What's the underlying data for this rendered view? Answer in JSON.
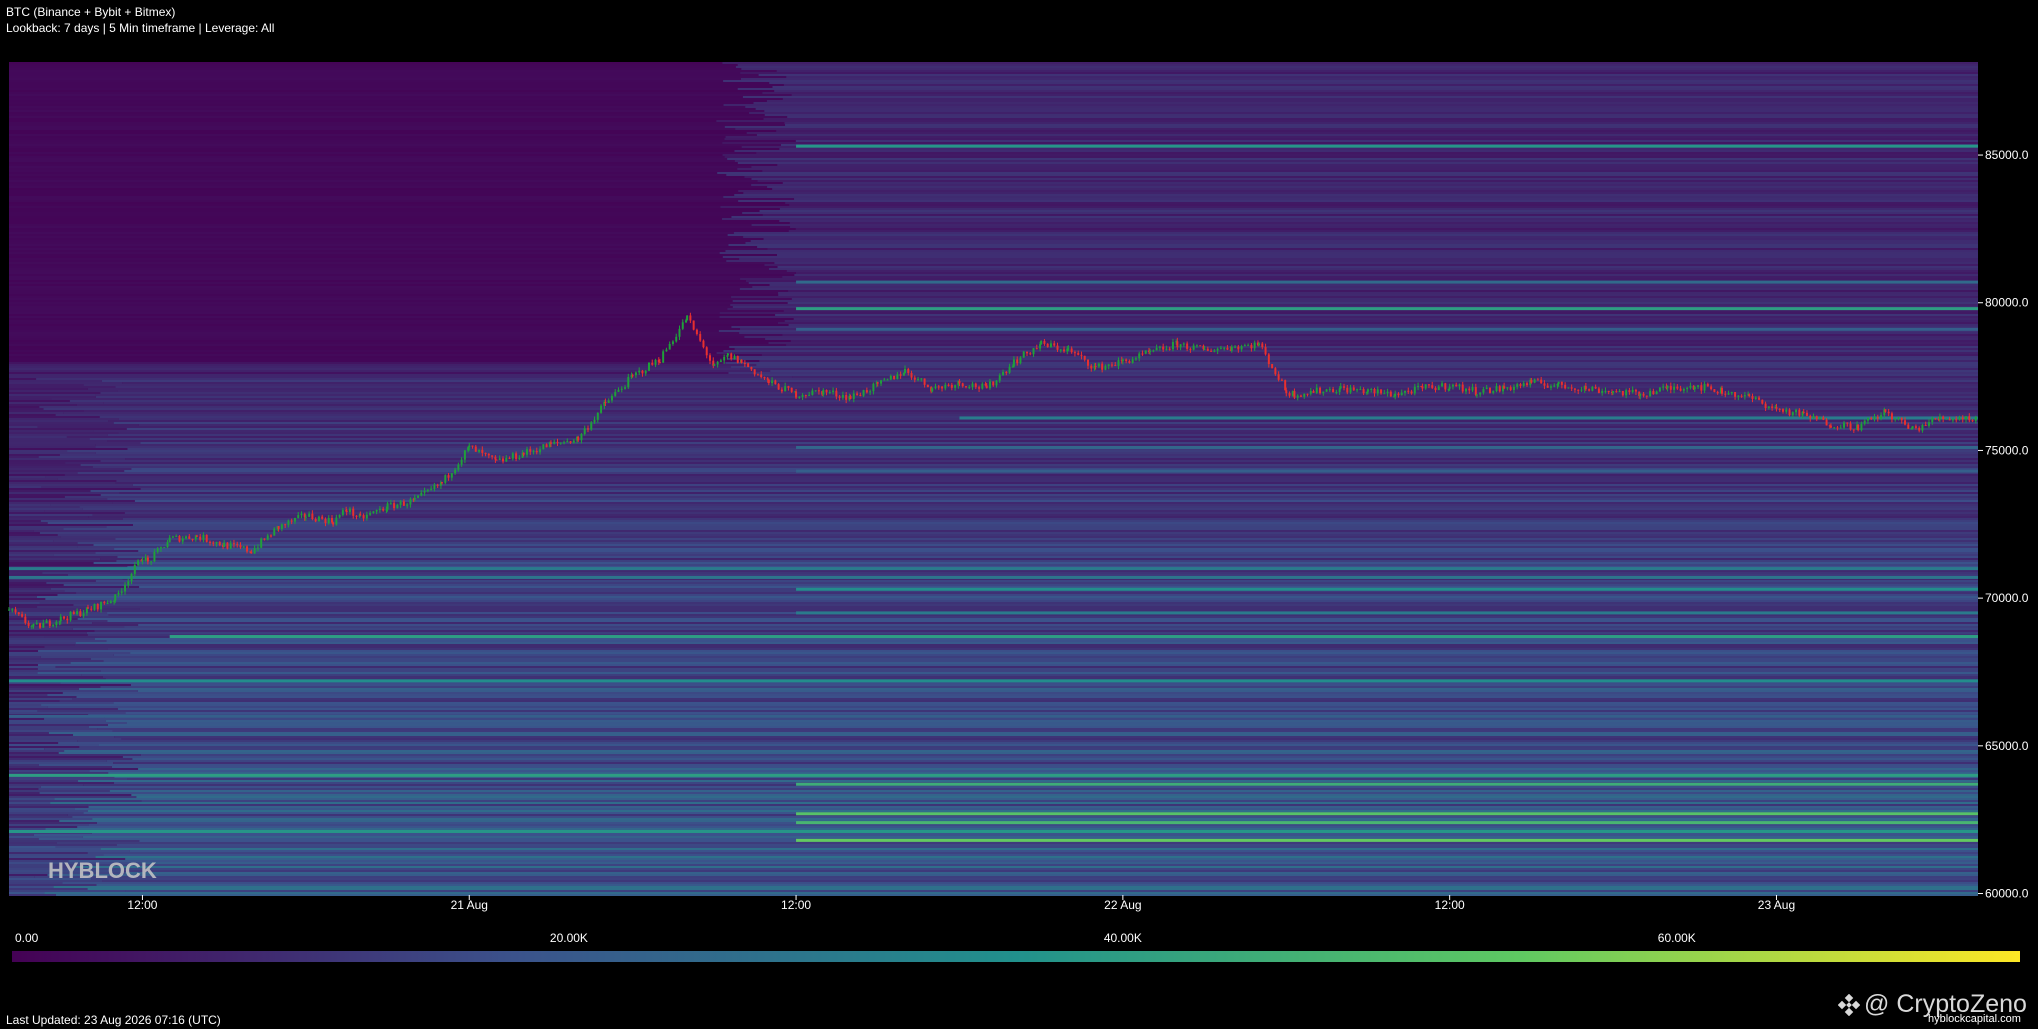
{
  "header": {
    "title": "BTC (Binance + Bybit + Bitmex)",
    "subtitle": "Lookback: 7 days | 5 Min timeframe | Leverage: All"
  },
  "watermark": {
    "logo_text": "HYBLOCK",
    "brand": "@ CryptoZeno",
    "brand_icon": "binance-diamond-icon",
    "url": "hyblockcapital.com"
  },
  "footer": {
    "last_updated": "Last Updated: 23 Aug 2026 07:16 (UTC)"
  },
  "chart_data": {
    "type": "heatmap",
    "title": "",
    "xlabel": "",
    "ylabel": "",
    "x_ticks": [
      "12:00",
      "21 Aug",
      "12:00",
      "22 Aug",
      "12:00",
      "23 Aug"
    ],
    "x_tick_hours": [
      12,
      24,
      36,
      48,
      60,
      72
    ],
    "x_range_hours": [
      7.1,
      79.4
    ],
    "y_ticks": [
      "85000.0",
      "80000.0",
      "75000.0",
      "70000.0",
      "65000.0",
      "60000.0"
    ],
    "y_tick_values": [
      85000,
      80000,
      75000,
      70000,
      65000,
      60000
    ],
    "ylim": [
      59950,
      88150
    ],
    "colorbar": {
      "ticks": [
        "0.00",
        "20.00K",
        "40.00K",
        "60.00K"
      ],
      "tick_values": [
        0,
        20000,
        40000,
        60000
      ],
      "range": [
        0,
        72500
      ],
      "colors": [
        "#440154",
        "#3b528b",
        "#21918c",
        "#5ec962",
        "#fde725"
      ]
    },
    "liquidation_levels": [
      {
        "price": 85300,
        "value": 38000,
        "start_hour": 36
      },
      {
        "price": 80700,
        "value": 25000,
        "start_hour": 36
      },
      {
        "price": 79800,
        "value": 40000,
        "start_hour": 36
      },
      {
        "price": 79100,
        "value": 22000,
        "start_hour": 36
      },
      {
        "price": 76100,
        "value": 30000,
        "start_hour": 42
      },
      {
        "price": 75100,
        "value": 24000,
        "start_hour": 36
      },
      {
        "price": 74300,
        "value": 22000,
        "start_hour": 36
      },
      {
        "price": 71000,
        "value": 30000,
        "start_hour": 7.1
      },
      {
        "price": 70700,
        "value": 28000,
        "start_hour": 7.1
      },
      {
        "price": 70300,
        "value": 35000,
        "start_hour": 36
      },
      {
        "price": 69500,
        "value": 30000,
        "start_hour": 36
      },
      {
        "price": 68700,
        "value": 40000,
        "start_hour": 13
      },
      {
        "price": 67200,
        "value": 35000,
        "start_hour": 7.1
      },
      {
        "price": 66000,
        "value": 22000,
        "start_hour": 7.1
      },
      {
        "price": 64000,
        "value": 40000,
        "start_hour": 7.1
      },
      {
        "price": 63700,
        "value": 45000,
        "start_hour": 36
      },
      {
        "price": 62700,
        "value": 52000,
        "start_hour": 36
      },
      {
        "price": 62400,
        "value": 48000,
        "start_hour": 36
      },
      {
        "price": 62100,
        "value": 38000,
        "start_hour": 7.1
      },
      {
        "price": 61800,
        "value": 55000,
        "start_hour": 36
      }
    ],
    "price_series": {
      "name": "",
      "x_hours": [
        7.1,
        8,
        9,
        10,
        11,
        12,
        12.2,
        13,
        14,
        15,
        16,
        17,
        18,
        19,
        19.5,
        20,
        21,
        22,
        23,
        24,
        25,
        26,
        27,
        28,
        29,
        30,
        31,
        32,
        33,
        33.5,
        34,
        35,
        36,
        37,
        38,
        39,
        40,
        41,
        42,
        43,
        44,
        45,
        46,
        47,
        48,
        49,
        50,
        51,
        52,
        53,
        54,
        54.3,
        55,
        56,
        57,
        58,
        59,
        60,
        61,
        62,
        63,
        64,
        65,
        66,
        67,
        68,
        69,
        70,
        71,
        72,
        73,
        74,
        75,
        76,
        77,
        78,
        79.4
      ],
      "close": [
        69600,
        69000,
        69300,
        69600,
        70000,
        71400,
        71200,
        72000,
        72100,
        71800,
        71600,
        72400,
        72800,
        72600,
        73000,
        72700,
        73100,
        73300,
        73900,
        75100,
        74600,
        74900,
        75200,
        75400,
        76600,
        77500,
        78100,
        79500,
        77800,
        78200,
        78000,
        77300,
        76900,
        77000,
        76800,
        77200,
        77700,
        77100,
        77300,
        77100,
        78000,
        78600,
        78400,
        77800,
        78000,
        78300,
        78600,
        78400,
        78500,
        78600,
        77000,
        76900,
        77000,
        77100,
        77000,
        76900,
        77100,
        77200,
        77000,
        77100,
        77300,
        77200,
        77100,
        77000,
        76900,
        77100,
        77200,
        77000,
        76800,
        76400,
        76200,
        75900,
        75800,
        76300,
        75700,
        76100,
        76100
      ],
      "up_color": "#1fa03a",
      "down_color": "#e8302f"
    }
  }
}
